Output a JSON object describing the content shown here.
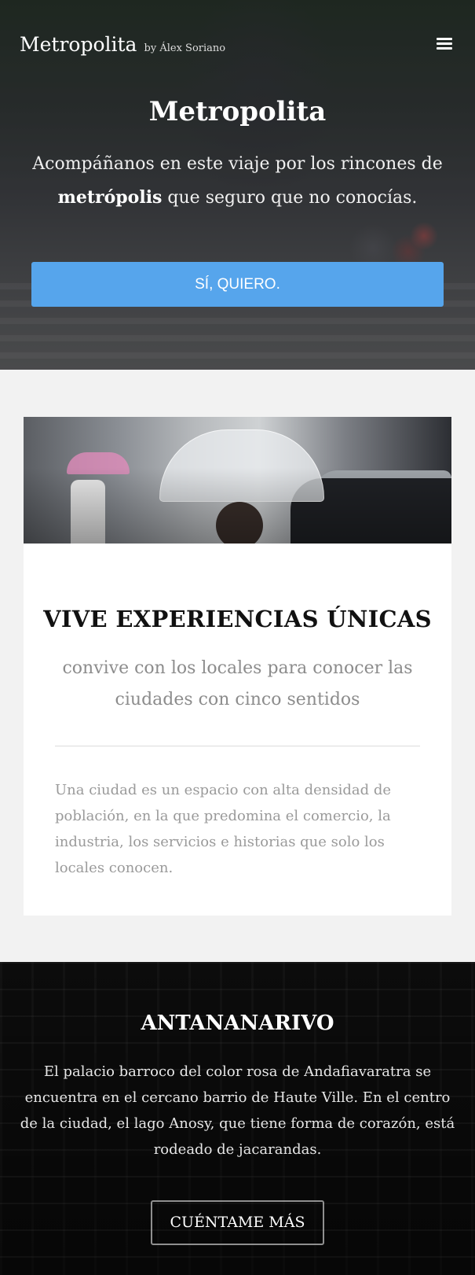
{
  "header": {
    "brand_name": "Metropolita",
    "brand_byline": "by Álex Soriano",
    "menu_icon": "hamburger-menu-icon"
  },
  "hero": {
    "title": "Metropolita",
    "subtitle_part1": "Acompáñanos en este viaje por los rincones de ",
    "subtitle_bold": "metrópolis",
    "subtitle_part2": " que seguro que no conocías.",
    "cta_label": "SÍ, QUIERO.",
    "cta_color": "#56a5ec"
  },
  "feature_card": {
    "title": "VIVE EXPERIENCIAS ÚNICAS",
    "subtitle": "convive con los locales para conocer las ciudades con cinco sentidos",
    "body": "Una ciudad es un espacio con alta densidad de población, en la que predomina el comercio, la industria, los servicios e historias que solo los locales conocen."
  },
  "city_section": {
    "title": "ANTANANARIVO",
    "body": "El palacio barroco del color rosa de Andafiavaratra se encuentra en el cercano barrio de Haute Ville. En el centro de la ciudad, el lago Anosy, que tiene forma de corazón, está rodeado de jacarandas.",
    "button_label": "CUÉNTAME MÁS"
  }
}
